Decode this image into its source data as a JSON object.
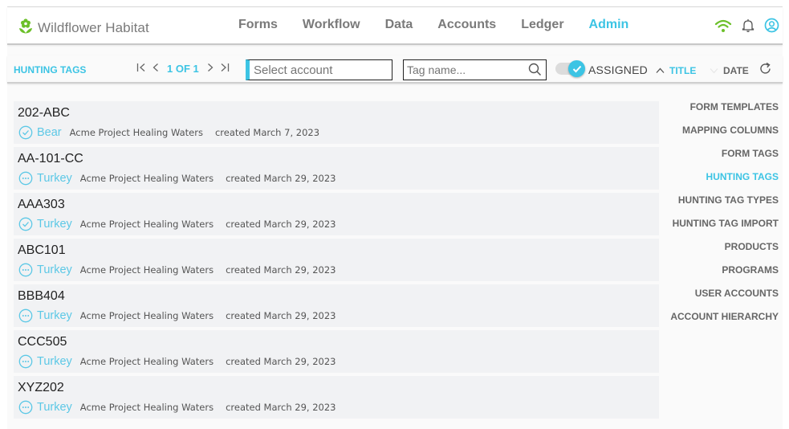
{
  "app": {
    "brand_name": "Wildflower Habitat",
    "brand_icon": "flower-icon",
    "accent_color": "#3cc4e4",
    "brand_color": "#6cc02a"
  },
  "nav": {
    "items": [
      {
        "label": "Forms",
        "active": false
      },
      {
        "label": "Workflow",
        "active": false
      },
      {
        "label": "Data",
        "active": false
      },
      {
        "label": "Accounts",
        "active": false
      },
      {
        "label": "Ledger",
        "active": false
      },
      {
        "label": "Admin",
        "active": true
      }
    ],
    "icons": [
      "wifi-icon",
      "bell-icon",
      "user-circle-icon"
    ]
  },
  "toolbar": {
    "title": "HUNTING TAGS",
    "pager": {
      "first": "first-page-icon",
      "prev": "prev-page-icon",
      "text": "1 OF 1",
      "next": "next-page-icon",
      "last": "last-page-icon"
    },
    "account_placeholder": "Select account",
    "tag_placeholder": "Tag name...",
    "assigned_label": "ASSIGNED",
    "assigned_on": true,
    "sort_title_label": "TITLE",
    "sort_date_label": "DATE"
  },
  "tags": [
    {
      "title": "202-ABC",
      "status": "check",
      "type": "Bear",
      "account": "Acme Project Healing Waters",
      "created": "created March 7, 2023"
    },
    {
      "title": "AA-101-CC",
      "status": "pending",
      "type": "Turkey",
      "account": "Acme Project Healing Waters",
      "created": "created March 29, 2023"
    },
    {
      "title": "AAA303",
      "status": "check",
      "type": "Turkey",
      "account": "Acme Project Healing Waters",
      "created": "created March 29, 2023"
    },
    {
      "title": "ABC101",
      "status": "pending",
      "type": "Turkey",
      "account": "Acme Project Healing Waters",
      "created": "created March 29, 2023"
    },
    {
      "title": "BBB404",
      "status": "pending",
      "type": "Turkey",
      "account": "Acme Project Healing Waters",
      "created": "created March 29, 2023"
    },
    {
      "title": "CCC505",
      "status": "pending",
      "type": "Turkey",
      "account": "Acme Project Healing Waters",
      "created": "created March 29, 2023"
    },
    {
      "title": "XYZ202",
      "status": "pending",
      "type": "Turkey",
      "account": "Acme Project Healing Waters",
      "created": "created March 29, 2023"
    }
  ],
  "side_menu": [
    {
      "label": "FORM TEMPLATES",
      "active": false
    },
    {
      "label": "MAPPING COLUMNS",
      "active": false
    },
    {
      "label": "FORM TAGS",
      "active": false
    },
    {
      "label": "HUNTING TAGS",
      "active": true
    },
    {
      "label": "HUNTING TAG TYPES",
      "active": false
    },
    {
      "label": "HUNTING TAG IMPORT",
      "active": false
    },
    {
      "label": "PRODUCTS",
      "active": false
    },
    {
      "label": "PROGRAMS",
      "active": false
    },
    {
      "label": "USER ACCOUNTS",
      "active": false
    },
    {
      "label": "ACCOUNT HIERARCHY",
      "active": false
    }
  ]
}
